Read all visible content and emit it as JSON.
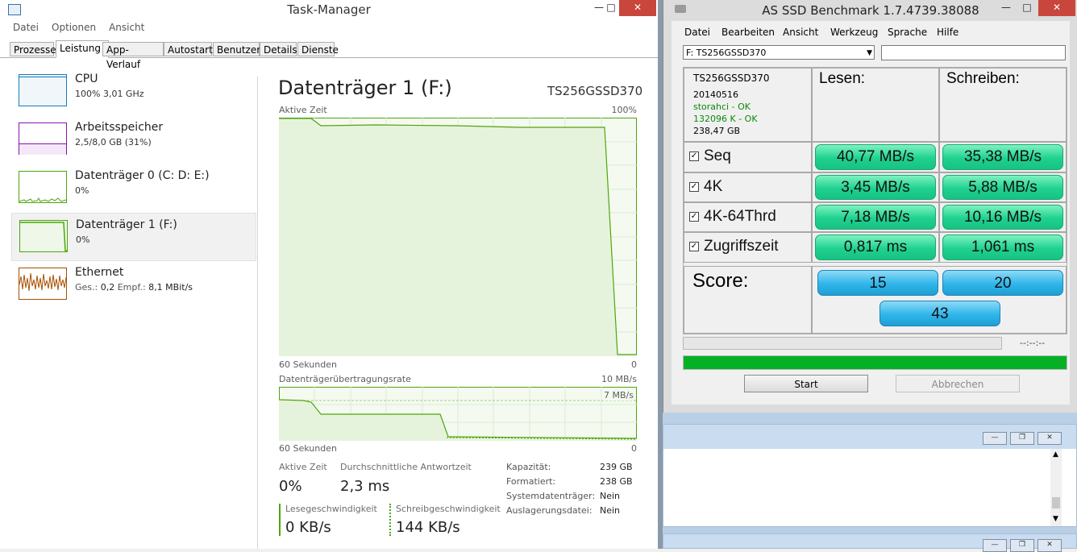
{
  "taskmanager": {
    "title": "Task-Manager",
    "menu": [
      "Datei",
      "Optionen",
      "Ansicht"
    ],
    "tabs": [
      "Prozesse",
      "Leistung",
      "App-Verlauf",
      "Autostart",
      "Benutzer",
      "Details",
      "Dienste"
    ],
    "active_tab": "Leistung",
    "sidebar": [
      {
        "name": "CPU",
        "detail": "100% 3,01 GHz",
        "color": "#117dbb"
      },
      {
        "name": "Arbeitsspeicher",
        "detail": "2,5/8,0 GB (31%)",
        "color": "#8b12ae"
      },
      {
        "name": "Datenträger 0 (C: D: E:)",
        "detail": "0%",
        "color": "#4da60c"
      },
      {
        "name": "Datenträger 1 (F:)",
        "detail": "0%",
        "color": "#4da60c"
      },
      {
        "name": "Ethernet",
        "detail_label1": "Ges.:",
        "detail_val1": "0,2",
        "detail_label2": "Empf.:",
        "detail_val2": "8,1 MBit/s",
        "color": "#a74f01"
      }
    ],
    "main": {
      "heading": "Datenträger 1 (F:)",
      "model": "TS256GSSD370",
      "chart1": {
        "label": "Aktive Zeit",
        "max": "100%",
        "x_left": "60 Sekunden",
        "x_right": "0"
      },
      "chart2": {
        "label": "Datenträgerübertragungsrate",
        "max": "10 MB/s",
        "line_label": "7 MB/s",
        "x_left": "60 Sekunden",
        "x_right": "0"
      },
      "stats": {
        "active_time_label": "Aktive Zeit",
        "active_time": "0%",
        "response_label": "Durchschnittliche Antwortzeit",
        "response": "2,3 ms",
        "read_label": "Lesegeschwindigkeit",
        "read": "0 KB/s",
        "write_label": "Schreibgeschwindigkeit",
        "write": "144 KB/s"
      },
      "props": [
        {
          "k": "Kapazität:",
          "v": "239 GB"
        },
        {
          "k": "Formatiert:",
          "v": "238 GB"
        },
        {
          "k": "Systemdatenträger:",
          "v": "Nein"
        },
        {
          "k": "Auslagerungsdatei:",
          "v": "Nein"
        }
      ]
    }
  },
  "asssd": {
    "title": "AS SSD Benchmark 1.7.4739.38088",
    "menu": [
      "Datei",
      "Bearbeiten",
      "Ansicht",
      "Werkzeug",
      "Sprache",
      "Hilfe"
    ],
    "drive_select": "F: TS256GSSD370",
    "info": {
      "model": "TS256GSSD370",
      "firmware": "20140516",
      "driver": "storahci - OK",
      "alignment": "132096 K - OK",
      "size": "238,47 GB"
    },
    "col_read": "Lesen:",
    "col_write": "Schreiben:",
    "rows": [
      {
        "label": "Seq",
        "read": "40,77 MB/s",
        "write": "35,38 MB/s"
      },
      {
        "label": "4K",
        "read": "3,45 MB/s",
        "write": "5,88 MB/s"
      },
      {
        "label": "4K-64Thrd",
        "read": "7,18 MB/s",
        "write": "10,16 MB/s"
      },
      {
        "label": "Zugriffszeit",
        "read": "0,817 ms",
        "write": "1,061 ms"
      }
    ],
    "score_label": "Score:",
    "score_read": "15",
    "score_write": "20",
    "score_total": "43",
    "time": "--:--:--",
    "progress": 1.0,
    "start_label": "Start",
    "cancel_label": "Abbrechen"
  }
}
